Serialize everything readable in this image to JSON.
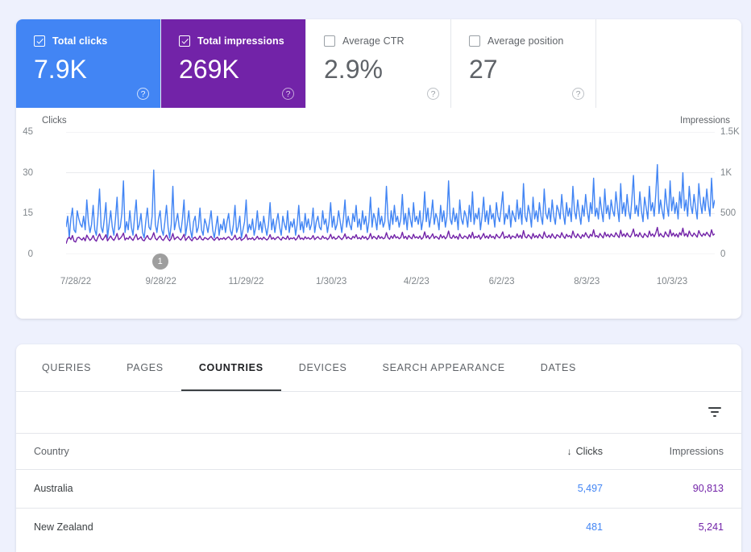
{
  "metrics": [
    {
      "id": "total-clicks",
      "label": "Total clicks",
      "value": "7.9K",
      "checked": true,
      "help": "?"
    },
    {
      "id": "total-impressions",
      "label": "Total impressions",
      "value": "269K",
      "checked": true,
      "help": "?"
    },
    {
      "id": "average-ctr",
      "label": "Average CTR",
      "value": "2.9%",
      "checked": false,
      "help": "?"
    },
    {
      "id": "average-position",
      "label": "Average position",
      "value": "27",
      "checked": false,
      "help": "?"
    }
  ],
  "chart": {
    "left_axis_title": "Clicks",
    "right_axis_title": "Impressions",
    "marker_label": "1"
  },
  "chart_data": {
    "type": "line",
    "title": "",
    "xlabel": "",
    "ylabel": "Clicks",
    "y2label": "Impressions",
    "grid": true,
    "legend_position": "none",
    "x_tick_labels": [
      "7/28/22",
      "9/28/22",
      "11/29/22",
      "1/30/23",
      "4/2/23",
      "6/2/23",
      "8/3/23",
      "10/3/23"
    ],
    "y_left": {
      "ticks": [
        0,
        15,
        30,
        45
      ],
      "tick_labels": [
        "0",
        "15",
        "30",
        "45"
      ],
      "ylim": [
        0,
        45
      ]
    },
    "y_right": {
      "ticks": [
        0,
        500,
        1000,
        1500
      ],
      "tick_labels": [
        "0",
        "500",
        "1K",
        "1.5K"
      ],
      "ylim": [
        0,
        1500
      ]
    },
    "annotations": [
      {
        "label": "1",
        "x_fraction": 0.145
      }
    ],
    "series": [
      {
        "name": "Clicks",
        "color": "#4285f4",
        "axis": "left",
        "values": [
          10,
          14,
          6,
          13,
          17,
          9,
          8,
          16,
          13,
          11,
          10,
          14,
          9,
          20,
          12,
          8,
          11,
          18,
          9,
          7,
          14,
          24,
          10,
          8,
          13,
          19,
          6,
          11,
          16,
          10,
          7,
          13,
          21,
          9,
          10,
          15,
          27,
          8,
          12,
          9,
          16,
          10,
          7,
          14,
          20,
          9,
          11,
          15,
          8,
          6,
          12,
          17,
          10,
          9,
          14,
          31,
          11,
          8,
          13,
          16,
          9,
          7,
          12,
          18,
          10,
          6,
          11,
          25,
          9,
          12,
          15,
          10,
          8,
          13,
          20,
          7,
          11,
          16,
          9,
          6,
          12,
          14,
          8,
          10,
          17,
          9,
          7,
          13,
          11,
          8,
          12,
          16,
          9,
          6,
          10,
          14,
          7,
          11,
          9,
          13,
          8,
          12,
          15,
          9,
          7,
          11,
          18,
          8,
          10,
          14,
          6,
          9,
          12,
          20,
          8,
          11,
          9,
          13,
          7,
          10,
          16,
          9,
          12,
          8,
          14,
          10,
          7,
          11,
          19,
          9,
          13,
          8,
          12,
          15,
          10,
          7,
          14,
          11,
          9,
          16,
          8,
          12,
          10,
          13,
          7,
          11,
          18,
          9,
          12,
          8,
          15,
          10,
          13,
          9,
          11,
          17,
          8,
          12,
          14,
          10,
          9,
          16,
          11,
          13,
          8,
          12,
          19,
          10,
          14,
          9,
          11,
          16,
          12,
          8,
          13,
          20,
          10,
          14,
          11,
          9,
          15,
          12,
          18,
          10,
          13,
          9,
          16,
          11,
          14,
          8,
          12,
          21,
          10,
          15,
          13,
          9,
          17,
          11,
          14,
          10,
          12,
          25,
          13,
          9,
          16,
          11,
          18,
          12,
          14,
          10,
          13,
          22,
          11,
          15,
          9,
          17,
          13,
          10,
          19,
          12,
          14,
          11,
          16,
          9,
          13,
          23,
          12,
          17,
          10,
          14,
          20,
          11,
          15,
          13,
          9,
          18,
          12,
          16,
          10,
          14,
          27,
          13,
          11,
          17,
          12,
          15,
          9,
          20,
          13,
          11,
          16,
          14,
          10,
          18,
          12,
          23,
          11,
          15,
          13,
          17,
          9,
          14,
          21,
          12,
          16,
          11,
          18,
          13,
          15,
          10,
          19,
          14,
          12,
          17,
          23,
          11,
          15,
          13,
          18,
          10,
          16,
          14,
          12,
          20,
          13,
          17,
          11,
          26,
          14,
          12,
          18,
          15,
          10,
          21,
          13,
          16,
          12,
          19,
          14,
          11,
          24,
          15,
          13,
          17,
          12,
          20,
          14,
          11,
          18,
          16,
          13,
          22,
          15,
          11,
          19,
          14,
          17,
          12,
          25,
          16,
          13,
          20,
          15,
          11,
          18,
          14,
          22,
          16,
          12,
          19,
          15,
          28,
          14,
          17,
          13,
          21,
          16,
          12,
          24,
          15,
          18,
          13,
          20,
          16,
          14,
          23,
          17,
          12,
          26,
          15,
          19,
          14,
          22,
          16,
          13,
          20,
          29,
          15,
          18,
          14,
          23,
          16,
          12,
          21,
          17,
          13,
          25,
          16,
          19,
          14,
          22,
          33,
          15,
          20,
          16,
          13,
          24,
          18,
          14,
          27,
          16,
          21,
          15,
          19,
          13,
          23,
          17,
          30,
          16,
          20,
          14,
          25,
          18,
          15,
          22,
          17,
          13,
          26,
          19,
          15,
          21,
          16,
          24,
          18,
          14,
          28,
          17,
          20
        ]
      },
      {
        "name": "Impressions",
        "color": "#7223a8",
        "axis": "right",
        "values": [
          130,
          190,
          210,
          180,
          230,
          160,
          150,
          200,
          210,
          190,
          175,
          205,
          165,
          235,
          200,
          170,
          190,
          230,
          180,
          160,
          210,
          250,
          195,
          175,
          205,
          240,
          165,
          195,
          225,
          190,
          170,
          205,
          255,
          180,
          195,
          220,
          260,
          175,
          200,
          185,
          220,
          190,
          170,
          210,
          245,
          180,
          195,
          215,
          175,
          165,
          200,
          230,
          190,
          180,
          210,
          265,
          195,
          175,
          205,
          225,
          185,
          170,
          200,
          235,
          190,
          165,
          195,
          255,
          180,
          200,
          215,
          190,
          175,
          205,
          245,
          170,
          195,
          220,
          185,
          165,
          200,
          210,
          180,
          190,
          225,
          185,
          175,
          205,
          195,
          180,
          200,
          220,
          190,
          170,
          195,
          210,
          175,
          195,
          185,
          205,
          180,
          200,
          215,
          190,
          175,
          195,
          235,
          180,
          190,
          210,
          170,
          185,
          200,
          245,
          180,
          195,
          185,
          205,
          175,
          190,
          220,
          185,
          200,
          180,
          210,
          190,
          175,
          195,
          240,
          185,
          205,
          180,
          200,
          215,
          190,
          175,
          210,
          195,
          185,
          225,
          180,
          200,
          190,
          205,
          175,
          195,
          235,
          185,
          200,
          180,
          215,
          190,
          205,
          185,
          195,
          230,
          180,
          200,
          215,
          190,
          185,
          225,
          195,
          205,
          180,
          200,
          245,
          190,
          215,
          185,
          195,
          225,
          200,
          180,
          205,
          250,
          190,
          215,
          195,
          185,
          220,
          200,
          240,
          190,
          205,
          185,
          225,
          195,
          215,
          180,
          200,
          255,
          190,
          220,
          205,
          185,
          230,
          195,
          215,
          190,
          200,
          265,
          205,
          185,
          225,
          195,
          240,
          200,
          215,
          190,
          205,
          270,
          195,
          220,
          185,
          230,
          205,
          190,
          245,
          200,
          215,
          195,
          225,
          185,
          205,
          275,
          200,
          230,
          190,
          215,
          250,
          195,
          220,
          205,
          185,
          240,
          200,
          225,
          190,
          215,
          285,
          205,
          195,
          235,
          200,
          220,
          185,
          250,
          205,
          195,
          225,
          215,
          190,
          240,
          200,
          270,
          195,
          220,
          205,
          235,
          185,
          215,
          255,
          200,
          225,
          195,
          240,
          205,
          220,
          190,
          245,
          215,
          200,
          230,
          275,
          195,
          220,
          205,
          240,
          190,
          225,
          215,
          200,
          250,
          205,
          235,
          195,
          290,
          215,
          200,
          240,
          220,
          190,
          255,
          205,
          230,
          200,
          245,
          215,
          195,
          275,
          220,
          205,
          235,
          200,
          250,
          215,
          195,
          240,
          225,
          205,
          265,
          220,
          195,
          245,
          215,
          230,
          200,
          285,
          225,
          205,
          250,
          220,
          195,
          240,
          215,
          265,
          225,
          200,
          245,
          220,
          300,
          215,
          230,
          205,
          255,
          225,
          200,
          270,
          220,
          245,
          210,
          250,
          225,
          215,
          265,
          230,
          205,
          295,
          220,
          250,
          215,
          260,
          225,
          210,
          250,
          310,
          220,
          245,
          215,
          265,
          225,
          205,
          255,
          230,
          210,
          285,
          225,
          250,
          215,
          260,
          330,
          220,
          255,
          225,
          210,
          275,
          240,
          215,
          300,
          225,
          260,
          220,
          250,
          210,
          265,
          235,
          320,
          225,
          255,
          215,
          285,
          240,
          220,
          260,
          235,
          210,
          290,
          245,
          220,
          255,
          230,
          270,
          240,
          215,
          300,
          235,
          250
        ]
      }
    ]
  },
  "table": {
    "tabs": [
      {
        "id": "queries",
        "label": "QUERIES",
        "active": false
      },
      {
        "id": "pages",
        "label": "PAGES",
        "active": false
      },
      {
        "id": "countries",
        "label": "COUNTRIES",
        "active": true
      },
      {
        "id": "devices",
        "label": "DEVICES",
        "active": false
      },
      {
        "id": "search-appearance",
        "label": "SEARCH APPEARANCE",
        "active": false
      },
      {
        "id": "dates",
        "label": "DATES",
        "active": false
      }
    ],
    "filter_icon": "filter-icon",
    "columns": {
      "country": "Country",
      "clicks": "Clicks",
      "impressions": "Impressions",
      "sort_arrow": "↓"
    },
    "rows": [
      {
        "country": "Australia",
        "clicks": "5,497",
        "impressions": "90,813"
      },
      {
        "country": "New Zealand",
        "clicks": "481",
        "impressions": "5,241"
      }
    ]
  },
  "colors": {
    "clicks": "#4285f4",
    "impressions": "#7223a8",
    "page_background": "#eef1fd",
    "card_background": "#ffffff",
    "text_primary": "#3c4043",
    "text_secondary": "#5f6368"
  }
}
